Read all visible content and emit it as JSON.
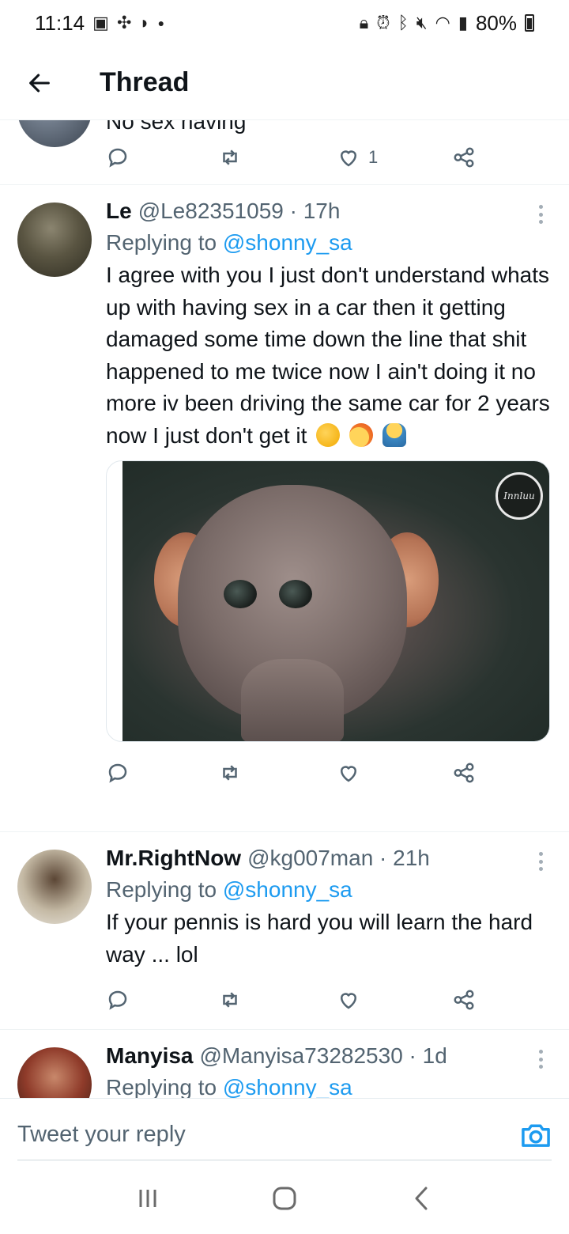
{
  "status_bar": {
    "time": "11:14",
    "battery": "80%",
    "left_icons": [
      "gallery-icon",
      "pinwheel-icon",
      "moon-icon",
      "dot-icon"
    ],
    "right_icons": [
      "lock-icon",
      "alarm-icon",
      "bluetooth-icon",
      "mute-icon",
      "wifi-icon",
      "signal-icon",
      "battery-icon"
    ]
  },
  "header": {
    "title": "Thread"
  },
  "partial_tweet": {
    "text": "No sex having",
    "like_count": "1"
  },
  "tweets": [
    {
      "name": "Le",
      "handle": "@Le82351059 · 17h",
      "replying_label": "Replying to",
      "replying_to": "@shonny_sa",
      "text": "I agree with you I just don't understand whats up with having sex in a car then it getting damaged some time down the line that shit happened to me twice now I ain't doing it no more iv been driving the same car for 2 years now I just don't get it",
      "watermark": "Innluu"
    },
    {
      "name": "Mr.RightNow",
      "handle": "@kg007man · 21h",
      "replying_label": "Replying to",
      "replying_to": "@shonny_sa",
      "text": "If your pennis is hard you will learn the hard way ... lol"
    },
    {
      "name": "Manyisa",
      "handle": "@Manyisa73282530 · 1d",
      "replying_label": "Replying to",
      "replying_to": "@shonny_sa"
    }
  ],
  "compose": {
    "placeholder": "Tweet your reply"
  },
  "colors": {
    "accent": "#1d9bf0",
    "secondary_text": "#536471",
    "primary_text": "#0f1419"
  }
}
